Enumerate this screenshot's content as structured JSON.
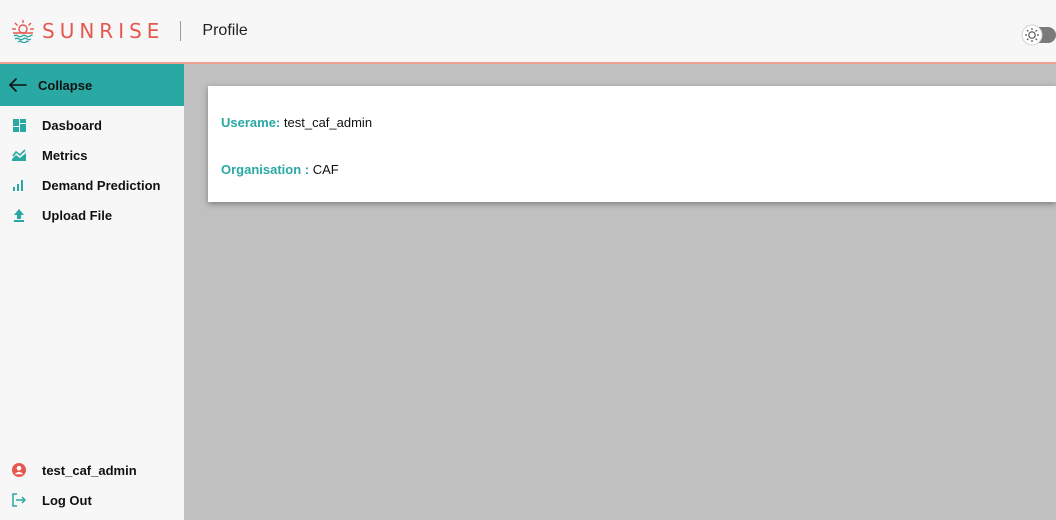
{
  "header": {
    "brand": "SUNRISE",
    "page_title": "Profile",
    "accent_color": "#e5584f"
  },
  "sidebar": {
    "collapse_label": "Collapse",
    "accent_color": "#2aa8a3",
    "items": [
      {
        "label": "Dasboard",
        "icon": "dashboard-icon"
      },
      {
        "label": "Metrics",
        "icon": "metrics-icon"
      },
      {
        "label": "Demand Prediction",
        "icon": "bar-chart-icon"
      },
      {
        "label": "Upload File",
        "icon": "upload-icon"
      }
    ],
    "user": {
      "label": "test_caf_admin",
      "icon": "user-icon"
    },
    "logout": {
      "label": "Log Out",
      "icon": "logout-icon"
    }
  },
  "profile": {
    "username_label": "Userame:",
    "username_value": "test_caf_admin",
    "organisation_label": "Organisation :",
    "organisation_value": "CAF"
  }
}
